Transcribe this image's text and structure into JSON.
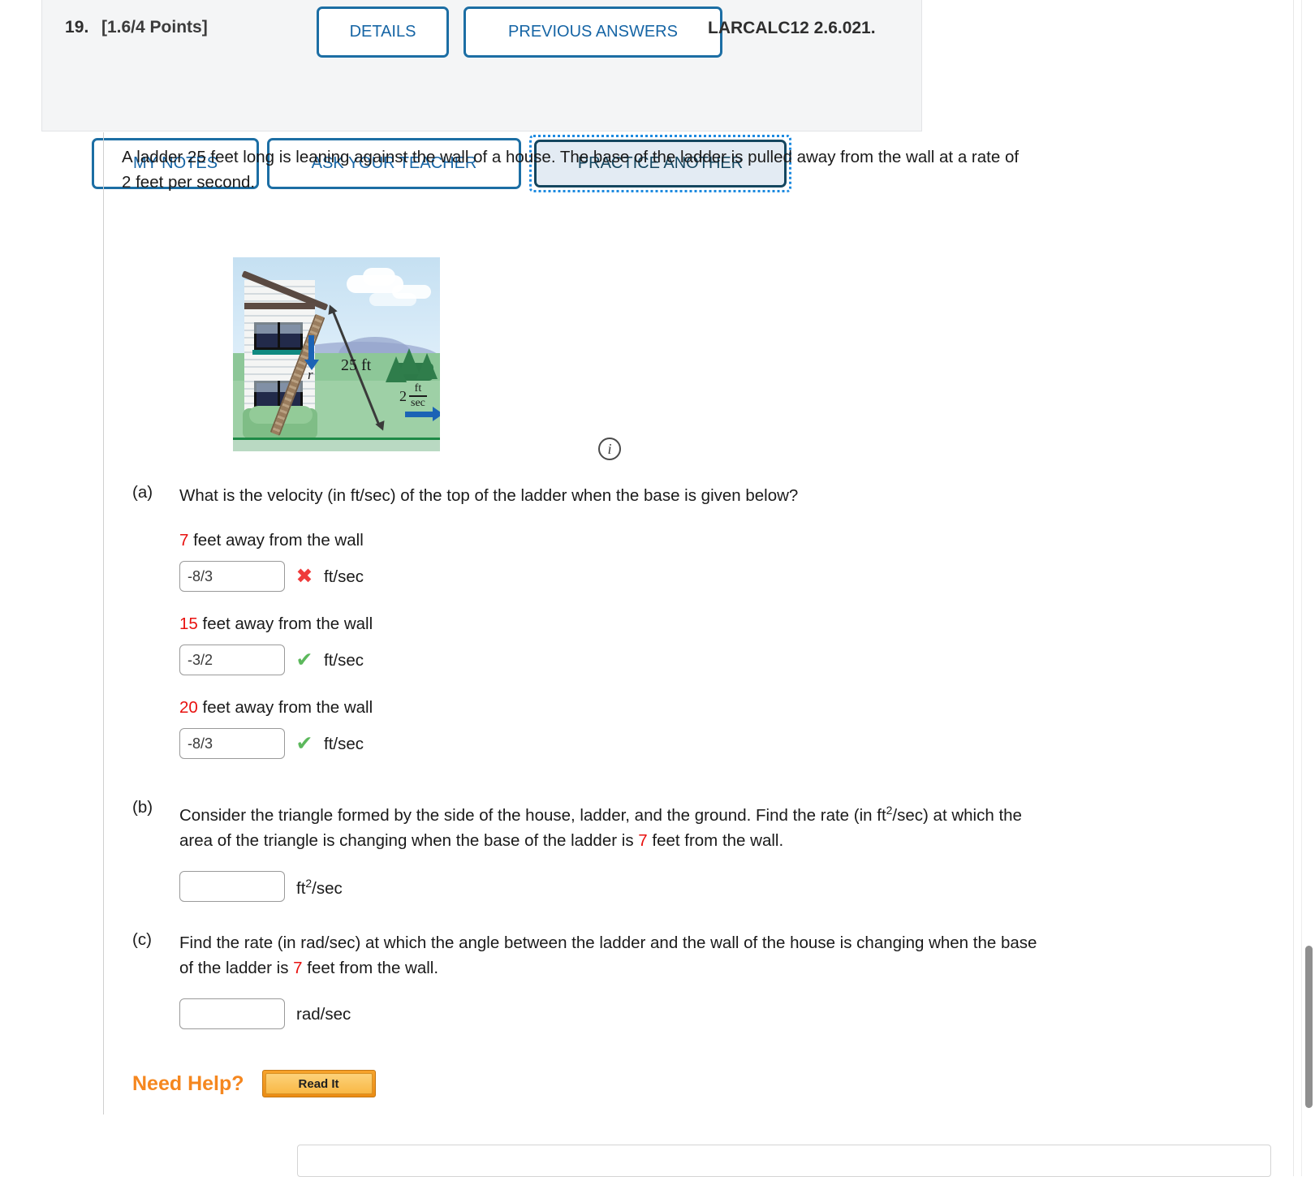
{
  "header": {
    "question_number": "19.",
    "points": "[1.6/4 Points]",
    "textbook_code": "LARCALC12 2.6.021.",
    "buttons": {
      "details": "DETAILS",
      "previous_answers": "PREVIOUS ANSWERS",
      "my_notes": "MY NOTES",
      "ask_your_teacher": "ASK YOUR TEACHER",
      "practice_another": "PRACTICE ANOTHER"
    }
  },
  "problem": {
    "line1": "A ladder 25 feet long is leaning against the wall of a house. The base of the ladder is pulled away from the wall at a rate of",
    "line2": "2 feet per second."
  },
  "figure": {
    "ladder_length_label": "25 ft",
    "rate_value": "2",
    "rate_numerator": "ft",
    "rate_denominator": "sec",
    "height_label": "r",
    "info_icon": "info-icon",
    "info_glyph": "i"
  },
  "parts": {
    "a": {
      "label": "(a)",
      "question": "What is the velocity (in ft/sec) of the top of the ladder when the base is given below?",
      "rows": [
        {
          "distance": "7",
          "distance_suffix": " feet away from the wall",
          "value": "-8/3",
          "mark": "wrong",
          "mark_glyph": "✖",
          "unit": "ft/sec"
        },
        {
          "distance": "15",
          "distance_suffix": " feet away from the wall",
          "value": "-3/2",
          "mark": "right",
          "mark_glyph": "✔",
          "unit": "ft/sec"
        },
        {
          "distance": "20",
          "distance_suffix": " feet away from the wall",
          "value": "-8/3",
          "mark": "right",
          "mark_glyph": "✔",
          "unit": "ft/sec"
        }
      ]
    },
    "b": {
      "label": "(b)",
      "text_1": "Consider the triangle formed by the side of the house, ladder, and the ground. Find the rate (in ft",
      "sup": "2",
      "text_2": "/sec) at which the",
      "text_3": "area of the triangle is changing when the base of the ladder is ",
      "highlight": "7",
      "text_4": " feet from the wall.",
      "value": "",
      "unit_pre": "ft",
      "unit_sup": "2",
      "unit_post": "/sec"
    },
    "c": {
      "label": "(c)",
      "text_1": "Find the rate (in rad/sec) at which the angle between the ladder and the wall of the house is changing when the base",
      "text_2": "of the ladder is ",
      "highlight": "7",
      "text_3": " feet from the wall.",
      "value": "",
      "unit": "rad/sec"
    }
  },
  "need_help": {
    "label": "Need Help?",
    "read_it": "Read It"
  },
  "colors": {
    "accent_blue": "#1665a5",
    "focus_blue": "#1c8ae0",
    "red": "#e8110f",
    "green": "#5cb85c",
    "wrong_red": "#ef3b3b",
    "orange": "#f5871f"
  }
}
